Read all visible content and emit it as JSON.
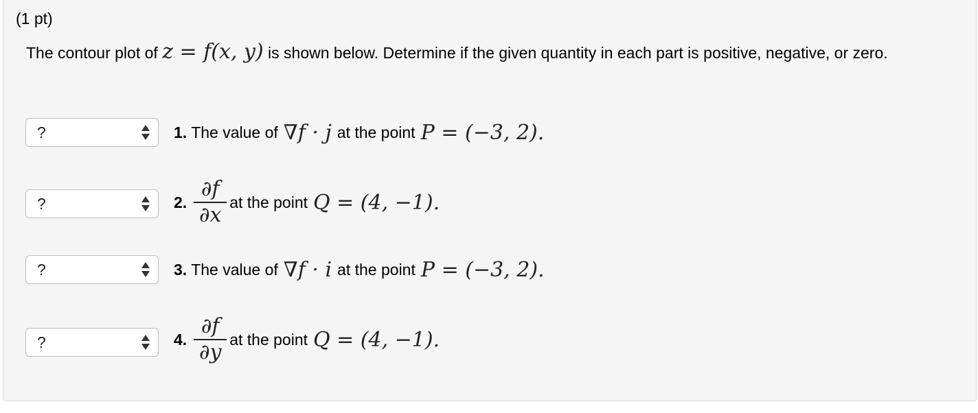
{
  "problem": {
    "points_label": "(1 pt)",
    "intro_before": "The contour plot of",
    "intro_math": "z = f(x, y)",
    "intro_after": "is shown below. Determine if the given quantity in each part is positive, negative, or zero."
  },
  "parts": [
    {
      "select_value": "?",
      "number": "1.",
      "text_before": "The value of",
      "math_expr": "∇f · j",
      "vector": "j",
      "text_after": "at the point",
      "point_math": "P = (−3, 2)."
    },
    {
      "select_value": "?",
      "number": "2.",
      "frac_num": "∂f",
      "frac_den": "∂x",
      "text_after": "at the point",
      "point_math": "Q = (4, −1)."
    },
    {
      "select_value": "?",
      "number": "3.",
      "text_before": "The value of",
      "math_expr": "∇f · i",
      "vector": "i",
      "text_after": "at the point",
      "point_math": "P = (−3, 2)."
    },
    {
      "select_value": "?",
      "number": "4.",
      "frac_num": "∂f",
      "frac_den": "∂y",
      "text_after": "at the point",
      "point_math": "Q = (4, −1)."
    }
  ],
  "icons": {
    "select_arrows": "up-down-arrows-icon"
  }
}
